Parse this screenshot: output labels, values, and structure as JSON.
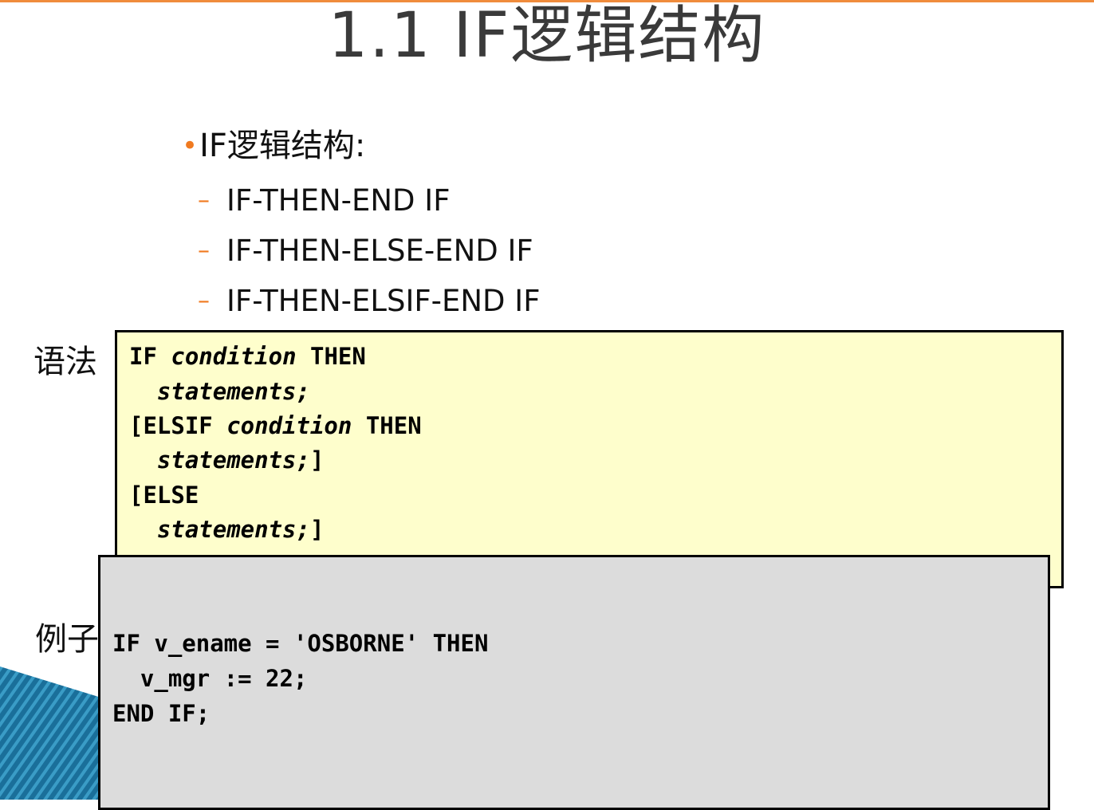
{
  "title": "1.1 IF逻辑结构",
  "bullet": {
    "label": "IF逻辑结构:",
    "items": [
      "IF-THEN-END IF",
      "IF-THEN-ELSE-END IF",
      "IF-THEN-ELSIF-END IF"
    ]
  },
  "syntax": {
    "label": "语法",
    "lines": [
      {
        "kw": "IF ",
        "em": "condition",
        "tail": " THEN"
      },
      {
        "kw": "  ",
        "em": "statements;",
        "tail": ""
      },
      {
        "kw": "[ELSIF ",
        "em": "condition",
        "tail": " THEN"
      },
      {
        "kw": "  ",
        "em": "statements;",
        "tail": "]"
      },
      {
        "kw": "[ELSE",
        "em": "",
        "tail": ""
      },
      {
        "kw": "  ",
        "em": "statements;",
        "tail": "]"
      }
    ]
  },
  "example": {
    "label": "例子",
    "lines": [
      "IF v_ename = 'OSBORNE' THEN",
      "  v_mgr := 22;",
      "END IF;"
    ]
  },
  "colors": {
    "accent": "#f07a20",
    "syntax_bg": "#fefecc",
    "example_bg": "#dcdcdc",
    "decor_blue": "#1f7ba6"
  }
}
